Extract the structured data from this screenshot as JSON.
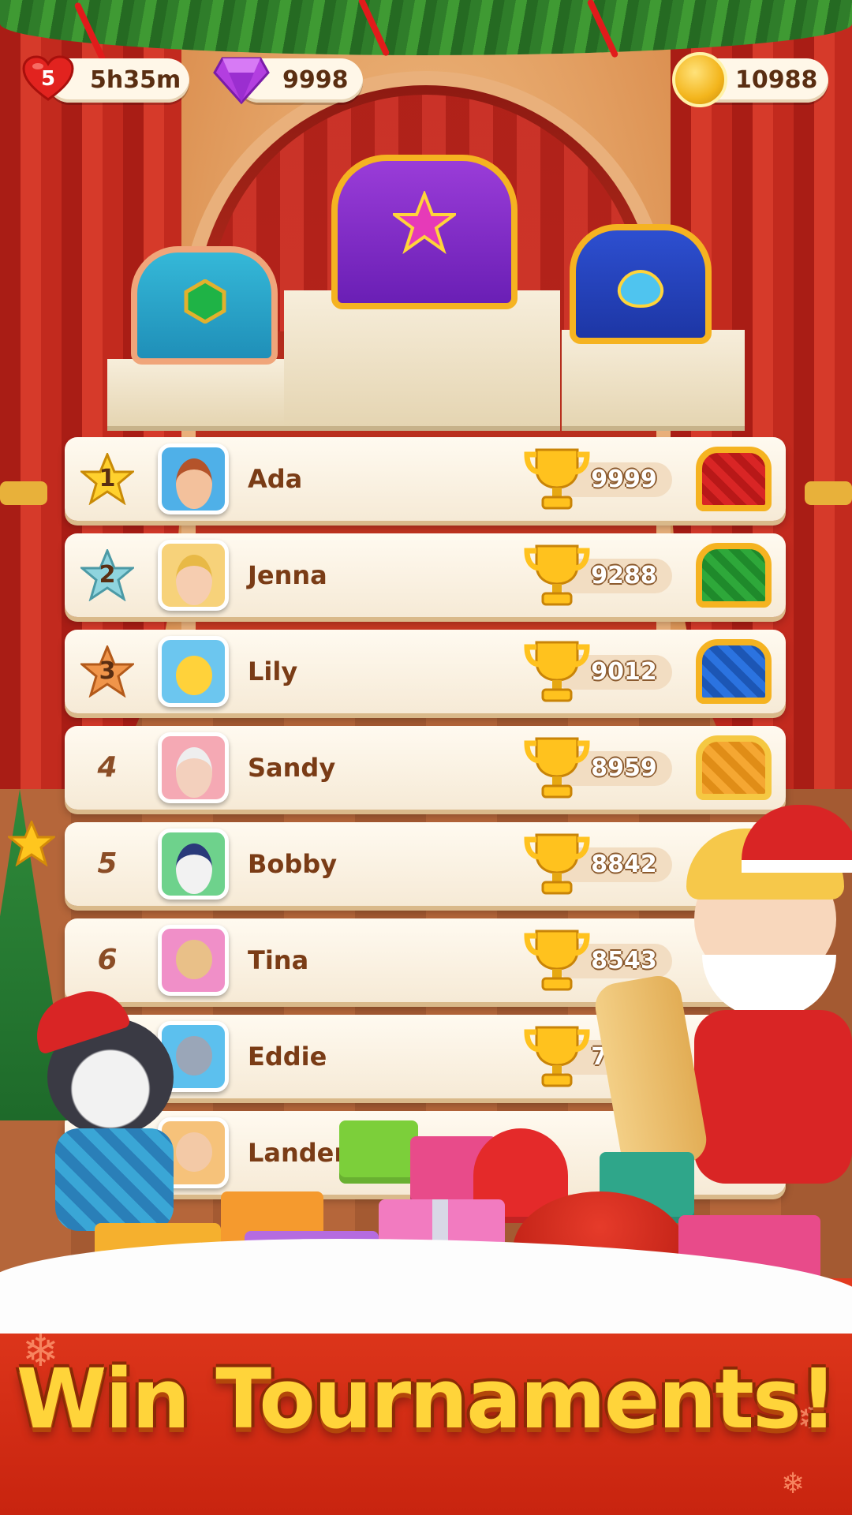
{
  "hud": {
    "lives": {
      "count": "5",
      "timer": "5h35m",
      "icon": "heart-icon"
    },
    "gems": {
      "value": "9998",
      "icon": "gem-icon"
    },
    "coins": {
      "value": "10988",
      "icon": "coin-icon"
    }
  },
  "podium": {
    "chests": [
      {
        "place": "1",
        "style": "purple-gold-star-chest"
      },
      {
        "place": "2",
        "style": "teal-green-gem-chest"
      },
      {
        "place": "3",
        "style": "blue-gold-shell-chest"
      }
    ]
  },
  "leaderboard": {
    "rows": [
      {
        "rank": "1",
        "name": "Ada",
        "score": "9999",
        "rank_style": "gold-star",
        "reward": "red-chest"
      },
      {
        "rank": "2",
        "name": "Jenna",
        "score": "9288",
        "rank_style": "teal-star",
        "reward": "green-chest"
      },
      {
        "rank": "3",
        "name": "Lily",
        "score": "9012",
        "rank_style": "bronze-star",
        "reward": "blue-chest"
      },
      {
        "rank": "4",
        "name": "Sandy",
        "score": "8959",
        "rank_style": "plain",
        "reward": "orange-chest"
      },
      {
        "rank": "5",
        "name": "Bobby",
        "score": "8842",
        "rank_style": "plain",
        "reward": ""
      },
      {
        "rank": "6",
        "name": "Tina",
        "score": "8543",
        "rank_style": "plain",
        "reward": ""
      },
      {
        "rank": "",
        "name": "Eddie",
        "score": "7524",
        "rank_style": "plain",
        "reward": ""
      },
      {
        "rank": "",
        "name": "Landen",
        "score": "",
        "rank_style": "plain",
        "reward": ""
      }
    ]
  },
  "banner": {
    "headline": "Win Tournaments!"
  },
  "colors": {
    "accent_gold": "#ffd43a",
    "curtain_red": "#c22a1e",
    "text_brown": "#7a3c16",
    "row_bg": "#fffaf0"
  }
}
